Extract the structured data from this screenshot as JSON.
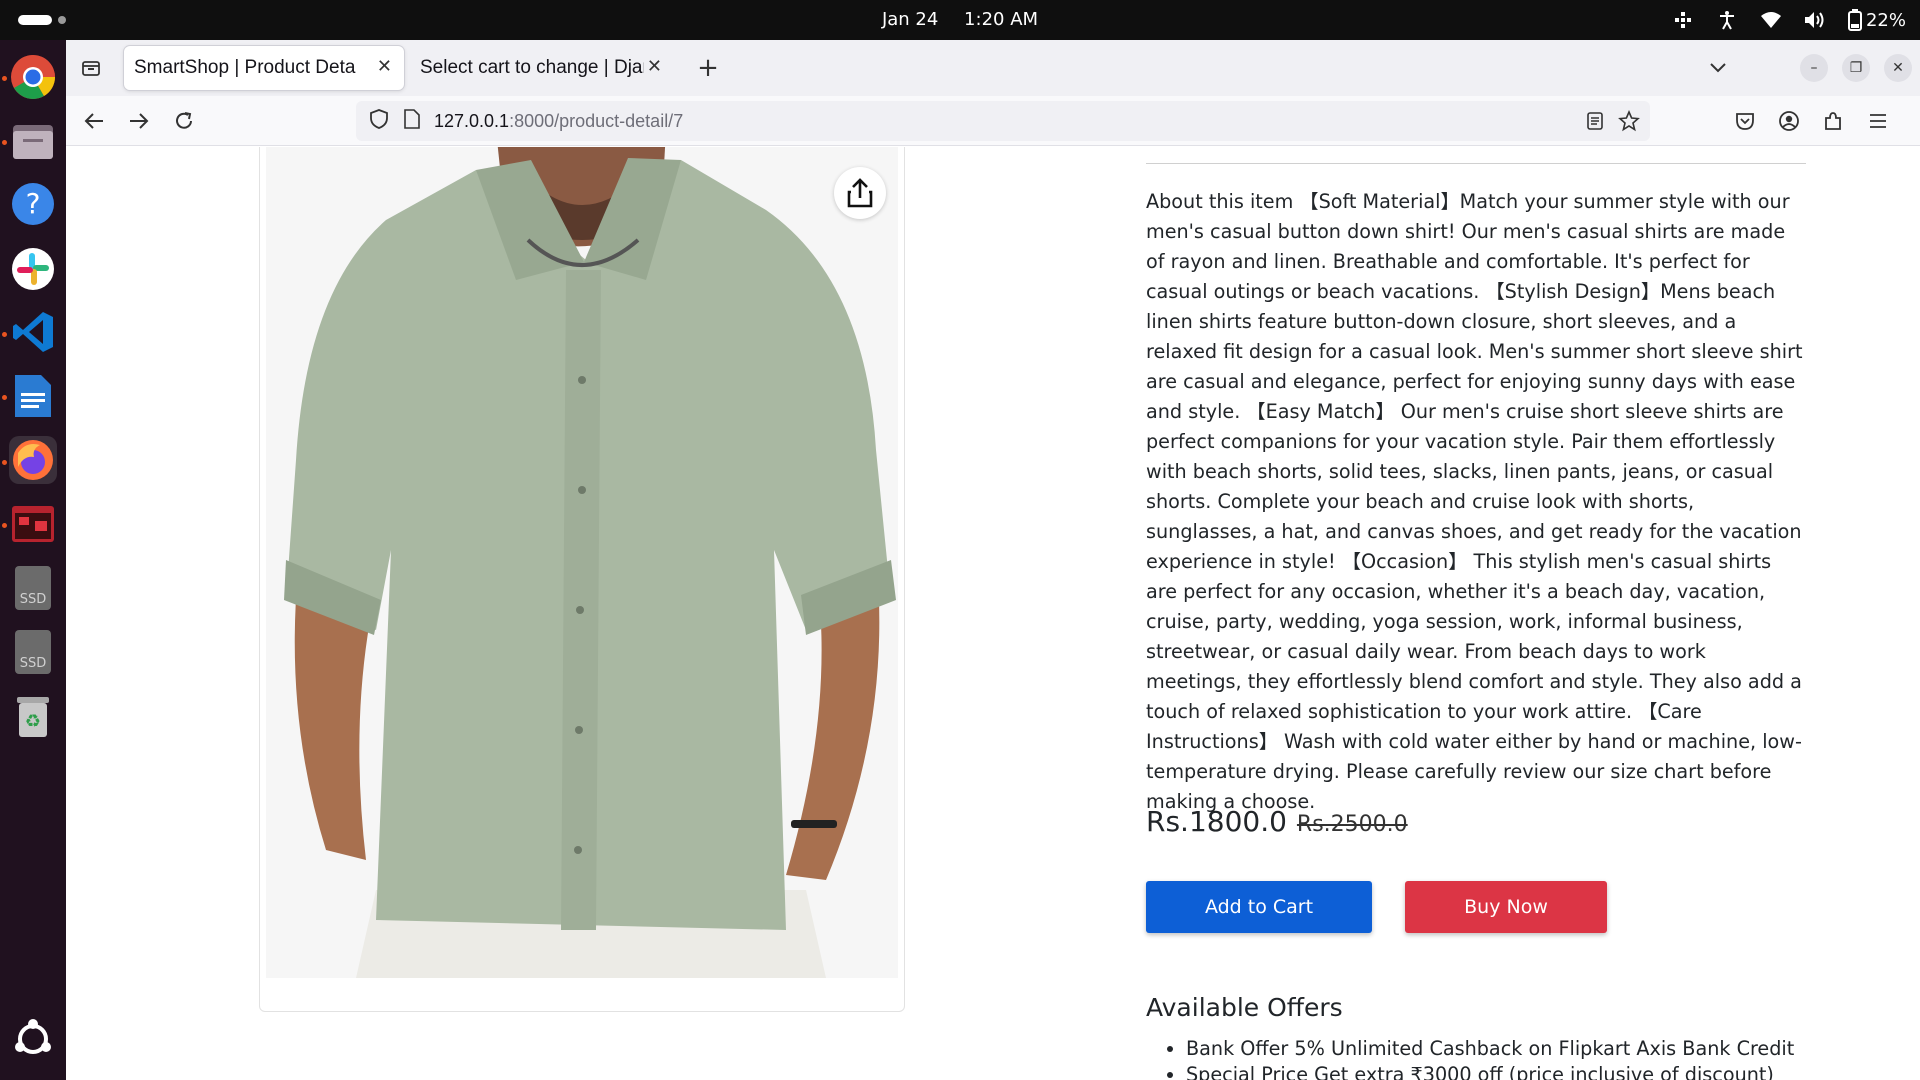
{
  "topbar": {
    "date": "Jan 24",
    "time": "1:20 AM",
    "battery": "22%",
    "icons": [
      "network-share-icon",
      "accessibility-icon",
      "wifi-icon",
      "volume-icon",
      "battery-icon"
    ]
  },
  "dock": {
    "items": [
      "chrome-icon",
      "files-icon",
      "help-icon",
      "slack-icon",
      "vscode-icon",
      "writer-icon",
      "firefox-icon",
      "terminal-app-icon",
      "ssd-drive-icon",
      "ssd-drive-icon",
      "trash-icon",
      "ubuntu-apps-icon"
    ],
    "ssd_label": "SSD"
  },
  "browser": {
    "tabs": [
      {
        "title": "SmartShop | Product Detail",
        "active": true
      },
      {
        "title": "Select cart to change | Django",
        "active": false
      }
    ],
    "url_host": "127.0.0.1",
    "url_path": ":8000/product-detail/7"
  },
  "product": {
    "description": "About this item 【Soft Material】Match your summer style with our men's casual button down shirt! Our men's casual shirts are made of rayon and linen. Breathable and comfortable. It's perfect for casual outings or beach vacations. 【Stylish Design】Mens beach linen shirts feature button-down closure, short sleeves, and a relaxed fit design for a casual look. Men's summer short sleeve shirt are casual and elegance, perfect for enjoying sunny days with ease and style. 【Easy Match】 Our men's cruise short sleeve shirts are perfect companions for your vacation style. Pair them effortlessly with beach shorts, solid tees, slacks, linen pants, jeans, or casual shorts. Complete your beach and cruise look with shorts, sunglasses, a hat, and canvas shoes, and get ready for the vacation experience in style! 【Occasion】 This stylish men's casual shirts are perfect for any occasion, whether it's a beach day, vacation, cruise, party, wedding, yoga session, work, informal business, streetwear, or casual daily wear. From beach days to work meetings, they effortlessly blend comfort and style. They also add a touch of relaxed sophistication to your work attire. 【Care Instructions】 Wash with cold water either by hand or machine, low-temperature drying. Please carefully review our size chart before making a choose.",
    "price": "Rs.1800.0",
    "mrp": "Rs.2500.0",
    "add_to_cart": "Add to Cart",
    "buy_now": "Buy Now",
    "offers_title": "Available Offers",
    "offers": [
      "Bank Offer 5% Unlimited Cashback on Flipkart Axis Bank Credit",
      "Special Price Get extra ₹3000 off (price inclusive of discount)"
    ]
  },
  "colors": {
    "add_to_cart": "#0d5fd6",
    "buy_now": "#dc3545",
    "shirt": "#a9b8a2"
  }
}
